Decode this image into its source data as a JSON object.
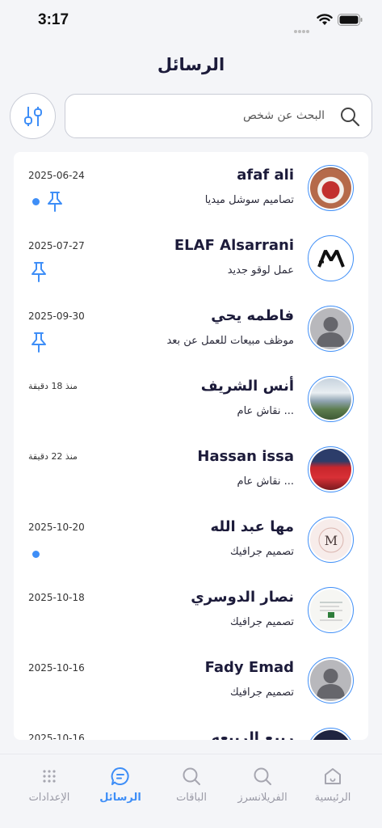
{
  "status": {
    "time": "3:17"
  },
  "page_title": "الرسائل",
  "search": {
    "placeholder": "البحث عن شخص"
  },
  "conversations": [
    {
      "name": "afaf ali",
      "preview": "تصاميم سوشل ميديا",
      "date": "2025-06-24",
      "unread": true,
      "pinned": true,
      "avatar": "photo-cup"
    },
    {
      "name": "ELAF Alsarrani",
      "preview": "عمل لوقو جديد",
      "date": "2025-07-27",
      "unread": false,
      "pinned": true,
      "avatar": "logo-m"
    },
    {
      "name": "فاطمه يحي",
      "preview": "موظف مبيعات للعمل عن بعد",
      "date": "2025-09-30",
      "unread": false,
      "pinned": true,
      "avatar": "default-user"
    },
    {
      "name": "أنس الشريف",
      "preview": "... نقاش عام",
      "date": "منذ 18 دقيقة",
      "unread": false,
      "pinned": false,
      "avatar": "photo-waterfall"
    },
    {
      "name": "Hassan issa",
      "preview": "... نقاش عام",
      "date": "منذ 22 دقيقة",
      "unread": false,
      "pinned": false,
      "avatar": "photo-team"
    },
    {
      "name": "مها عبد الله",
      "preview": "تصميم جرافيك",
      "date": "2025-10-20",
      "unread": true,
      "pinned": false,
      "avatar": "logo-m-pink"
    },
    {
      "name": "نصار الدوسري",
      "preview": "تصميم جرافيك",
      "date": "2025-10-18",
      "unread": false,
      "pinned": false,
      "avatar": "document"
    },
    {
      "name": "Fady Emad",
      "preview": "تصميم جرافيك",
      "date": "2025-10-16",
      "unread": false,
      "pinned": false,
      "avatar": "default-user"
    },
    {
      "name": "ربيع الربيعه",
      "preview": "",
      "date": "2025-10-16",
      "unread": false,
      "pinned": false,
      "avatar": "dark"
    }
  ],
  "tabs": [
    {
      "label": "الإعدادات",
      "icon": "grid-icon",
      "active": false
    },
    {
      "label": "الرسائل",
      "icon": "chat-icon",
      "active": true
    },
    {
      "label": "الباقات",
      "icon": "search-icon",
      "active": false
    },
    {
      "label": "الفريلانسرز",
      "icon": "search-icon",
      "active": false
    },
    {
      "label": "الرئيسية",
      "icon": "home-icon",
      "active": false
    }
  ],
  "colors": {
    "accent": "#3e8ef7",
    "title": "#1c1b3a",
    "background": "#f4f5f8"
  }
}
